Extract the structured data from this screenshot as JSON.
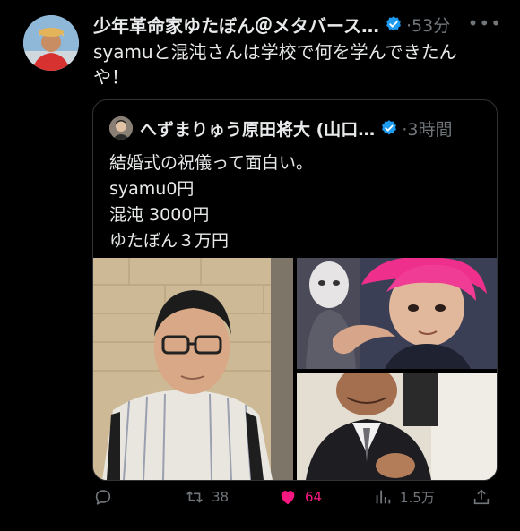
{
  "tweet": {
    "author": "少年革命家ゆたぼん＠メタバース…",
    "time": "53分",
    "more_icon": "more-horizontal-icon",
    "text": "syamuと混沌さんは学校で何を学んできたんや！"
  },
  "quote": {
    "author": "へずまりゅう原田将大 (山口…",
    "time": "3時間",
    "lines": [
      "結婚式の祝儀って面白い。",
      "syamu0円",
      "混沌 3000円",
      "ゆたぼん３万円"
    ]
  },
  "actions": {
    "reply_icon": "reply-icon",
    "retweet_count": "38",
    "like_count": "64",
    "views_count": "1.5万",
    "share_icon": "share-icon"
  },
  "colors": {
    "verified": "#1d9bf0",
    "like": "#f91880",
    "muted": "#71767b"
  }
}
